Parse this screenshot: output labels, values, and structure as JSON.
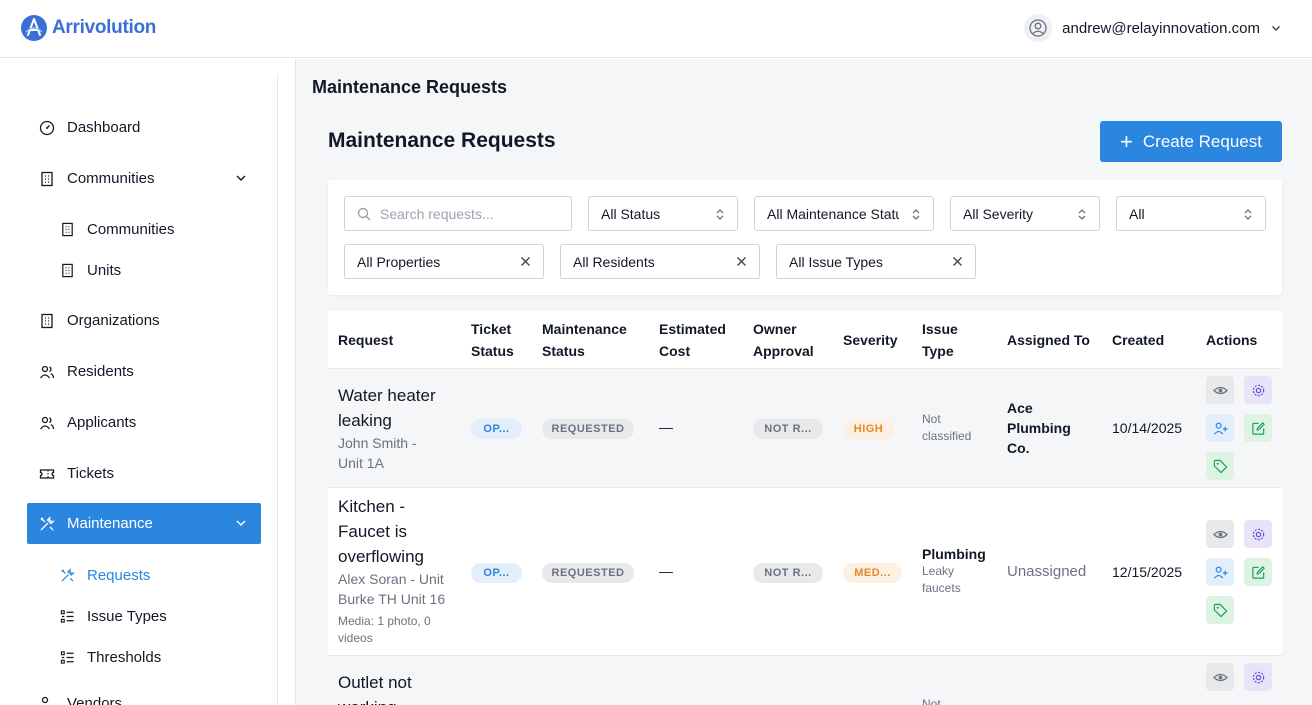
{
  "app": {
    "logo_text": "Arrivolution",
    "user_email": "andrew@relayinnovation.com"
  },
  "sidebar": {
    "items": [
      {
        "label": "Dashboard",
        "icon": "dashboard-icon"
      },
      {
        "label": "Communities",
        "icon": "building-icon"
      },
      {
        "label": "Communities",
        "icon": "building-icon"
      },
      {
        "label": "Units",
        "icon": "building-icon"
      },
      {
        "label": "Organizations",
        "icon": "building-icon"
      },
      {
        "label": "Residents",
        "icon": "users-icon"
      },
      {
        "label": "Applicants",
        "icon": "users-icon"
      },
      {
        "label": "Tickets",
        "icon": "ticket-icon"
      },
      {
        "label": "Maintenance",
        "icon": "tools-icon"
      },
      {
        "label": "Requests",
        "icon": "tools-icon"
      },
      {
        "label": "Issue Types",
        "icon": "list-icon"
      },
      {
        "label": "Thresholds",
        "icon": "list-icon"
      },
      {
        "label": "Vendors",
        "icon": "vendor-icon"
      }
    ]
  },
  "main": {
    "page_title": "Maintenance Requests",
    "section_title": "Maintenance Requests",
    "create_label": "Create Request"
  },
  "filters": {
    "search_placeholder": "Search requests...",
    "status": "All Status",
    "maintenance_status": "All Maintenance Status",
    "severity": "All Severity",
    "other": "All",
    "properties": "All Properties",
    "residents": "All Residents",
    "issue_types": "All Issue Types"
  },
  "table": {
    "headers": {
      "request": "Request",
      "ticket_status_1": "Ticket",
      "ticket_status_2": "Status",
      "maint_status_1": "Maintenance",
      "maint_status_2": "Status",
      "est_cost_1": "Estimated",
      "est_cost_2": "Cost",
      "owner_approval_1": "Owner",
      "owner_approval_2": "Approval",
      "severity": "Severity",
      "issue_type_1": "Issue",
      "issue_type_2": "Type",
      "assigned_to": "Assigned To",
      "created": "Created",
      "actions": "Actions"
    },
    "rows": [
      {
        "title_1": "Water heater",
        "title_2": "leaking",
        "sub_1": "John Smith -",
        "sub_2": "Unit 1A",
        "ticket_status": "OP...",
        "maint_status": "REQUESTED",
        "est_cost": "—",
        "owner_approval": "NOT R...",
        "severity": "HIGH",
        "issue_type_1": "Not",
        "issue_type_2": "classified",
        "assigned_1": "Ace",
        "assigned_2": "Plumbing",
        "assigned_3": "Co.",
        "created": "10/14/2025"
      },
      {
        "title_1": "Kitchen -",
        "title_2": "Faucet is",
        "title_3": "overflowing",
        "sub_1": "Alex Soran - Unit",
        "sub_2": "Burke TH Unit 16",
        "media_1": "Media: 1 photo, 0",
        "media_2": "videos",
        "ticket_status": "OP...",
        "maint_status": "REQUESTED",
        "est_cost": "—",
        "owner_approval": "NOT R...",
        "severity": "MED...",
        "issue_type_main": "Plumbing",
        "issue_type_sub_1": "Leaky",
        "issue_type_sub_2": "faucets",
        "assigned": "Unassigned",
        "created": "12/15/2025"
      },
      {
        "title_1": "Outlet not",
        "title_2": "working",
        "issue_type_1": "Not"
      }
    ]
  },
  "colors": {
    "primary": "#2b86e0",
    "brand": "#3b6fd6",
    "severity_orange": "#e3892b"
  }
}
